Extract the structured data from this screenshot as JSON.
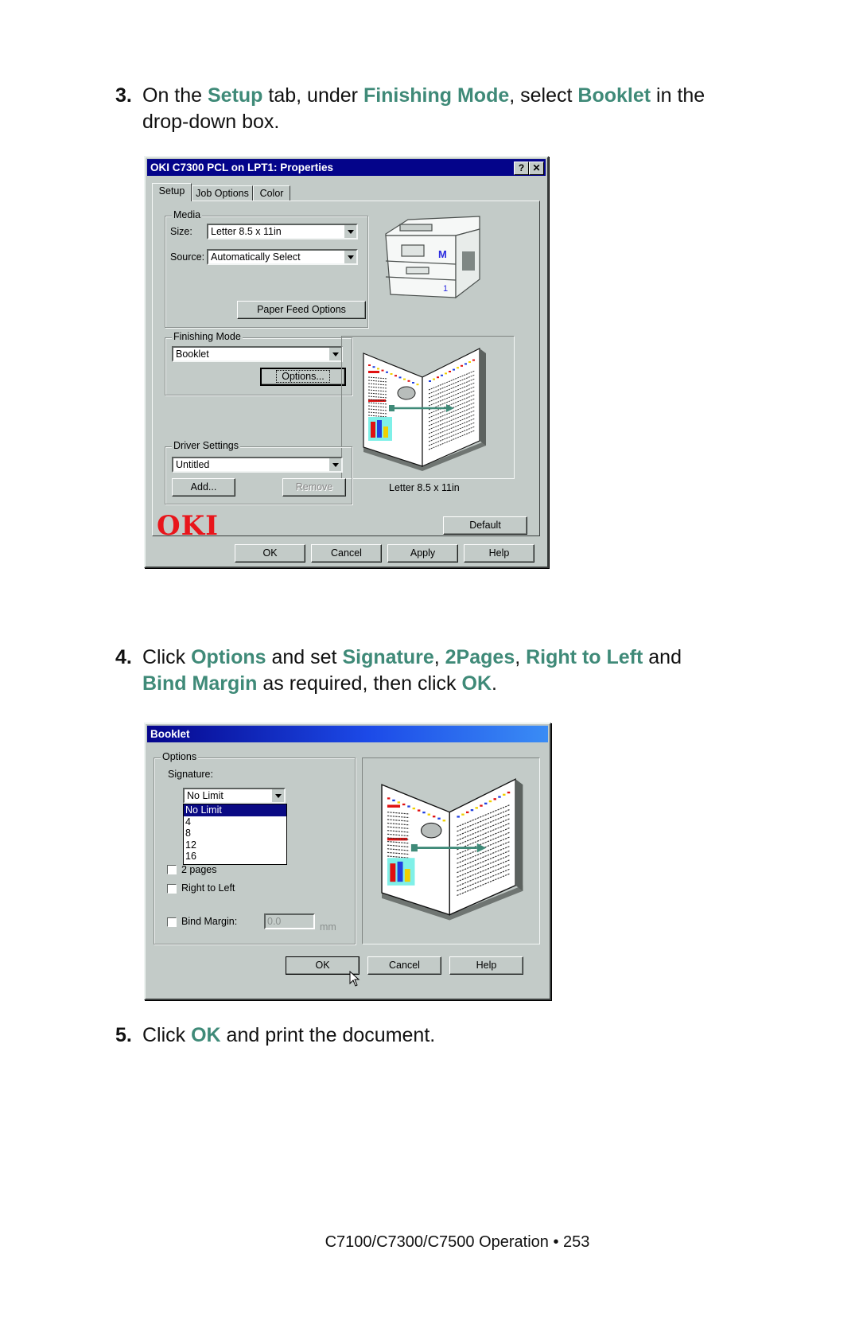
{
  "steps": [
    {
      "number": "3.",
      "segments": [
        {
          "text": "On the ",
          "hl": false
        },
        {
          "text": "Setup",
          "hl": true
        },
        {
          "text": " tab, under ",
          "hl": false
        },
        {
          "text": "Finishing Mode",
          "hl": true
        },
        {
          "text": ", select ",
          "hl": false
        },
        {
          "text": "Booklet",
          "hl": true
        },
        {
          "text": " in the",
          "hl": false
        }
      ],
      "continuation": [
        {
          "text": "drop-down box.",
          "hl": false
        }
      ]
    },
    {
      "number": "4.",
      "segments": [
        {
          "text": "Click ",
          "hl": false
        },
        {
          "text": "Options",
          "hl": true
        },
        {
          "text": " and set ",
          "hl": false
        },
        {
          "text": "Signature",
          "hl": true
        },
        {
          "text": ", ",
          "hl": false
        },
        {
          "text": "2Pages",
          "hl": true
        },
        {
          "text": ", ",
          "hl": false
        },
        {
          "text": "Right to Left",
          "hl": true
        },
        {
          "text": " and",
          "hl": false
        }
      ],
      "continuation": [
        {
          "text": "Bind Margin",
          "hl": true
        },
        {
          "text": " as required, then click ",
          "hl": false
        },
        {
          "text": "OK",
          "hl": true
        },
        {
          "text": ".",
          "hl": false
        }
      ]
    },
    {
      "number": "5.",
      "segments": [
        {
          "text": "Click ",
          "hl": false
        },
        {
          "text": "OK",
          "hl": true
        },
        {
          "text": " and print the document.",
          "hl": false
        }
      ],
      "continuation": []
    }
  ],
  "properties_dialog": {
    "title": "OKI C7300 PCL on LPT1: Properties",
    "help_glyph": "?",
    "close_glyph": "✕",
    "tabs": [
      "Setup",
      "Job Options",
      "Color"
    ],
    "active_tab": "Setup",
    "media": {
      "group_label": "Media",
      "size_label": "Size:",
      "size_value": "Letter 8.5 x 11in",
      "source_label": "Source:",
      "source_value": "Automatically Select",
      "paper_feed_button": "Paper Feed Options"
    },
    "finishing": {
      "group_label": "Finishing Mode",
      "value": "Booklet",
      "options_button": "Options..."
    },
    "driver_settings": {
      "group_label": "Driver Settings",
      "value": "Untitled",
      "add_button": "Add...",
      "remove_button": "Remove"
    },
    "printer_tray_labels": {
      "tray_m": "M",
      "tray_1": "1"
    },
    "preview_caption": "Letter 8.5 x 11in",
    "logo": "OKI",
    "default_button": "Default",
    "buttons": {
      "ok": "OK",
      "cancel": "Cancel",
      "apply": "Apply",
      "help": "Help"
    }
  },
  "booklet_dialog": {
    "title": "Booklet",
    "group_label": "Options",
    "signature_label": "Signature:",
    "signature_value": "No Limit",
    "signature_options": [
      "No Limit",
      "4",
      "8",
      "12",
      "16"
    ],
    "signature_selected": "No Limit",
    "checkboxes": {
      "two_pages": {
        "label": "2 pages",
        "checked": false
      },
      "right_to_left": {
        "label": "Right to Left",
        "checked": false
      },
      "bind_margin": {
        "label": "Bind Margin:",
        "checked": false
      }
    },
    "bind_margin_value": "0.0",
    "bind_margin_unit": "mm",
    "buttons": {
      "ok": "OK",
      "cancel": "Cancel",
      "help": "Help"
    }
  },
  "colors": {
    "highlight_text": "#3f8a78",
    "dialog_face": "#c3cbc8",
    "title_bar": "#04048a",
    "oki_red": "#e8151b"
  },
  "footer": {
    "text": "C7100/C7300/C7500  Operation • 253"
  }
}
